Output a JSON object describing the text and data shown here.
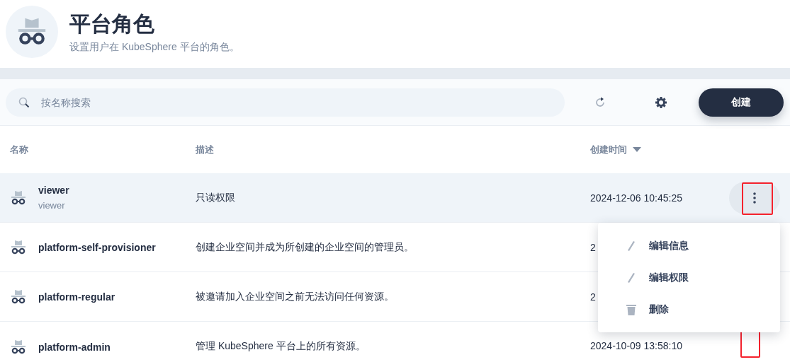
{
  "header": {
    "title": "平台角色",
    "description": "设置用户在 KubeSphere 平台的角色。"
  },
  "toolbar": {
    "search": {
      "placeholder": "按名称搜索"
    },
    "create_button": "创建"
  },
  "table": {
    "columns": [
      {
        "label": "名称",
        "sortable": false
      },
      {
        "label": "描述",
        "sortable": false
      },
      {
        "label": "创建时间",
        "sortable": true
      }
    ],
    "rows": [
      {
        "name": "viewer",
        "alias": "viewer",
        "description": "只读权限",
        "created": "2024-12-06 10:45:25",
        "hovered": true,
        "more_button": true,
        "highlighted": true
      },
      {
        "name": "platform-self-provisioner",
        "description": "创建企业空间并成为所创建的企业空间的管理员。",
        "created": "2",
        "hovered": false,
        "more_button": false,
        "highlighted": false
      },
      {
        "name": "platform-regular",
        "description": "被邀请加入企业空间之前无法访问任何资源。",
        "created": "2",
        "hovered": false,
        "more_button": false,
        "highlighted": false
      },
      {
        "name": "platform-admin",
        "description": "管理 KubeSphere 平台上的所有资源。",
        "created": "2024-10-09 13:58:10",
        "hovered": false,
        "more_button": false,
        "highlighted": true
      }
    ]
  },
  "menu": {
    "items": [
      {
        "label": "编辑信息",
        "kind": "edit"
      },
      {
        "label": "编辑权限",
        "kind": "edit"
      },
      {
        "label": "删除",
        "kind": "delete"
      }
    ]
  }
}
